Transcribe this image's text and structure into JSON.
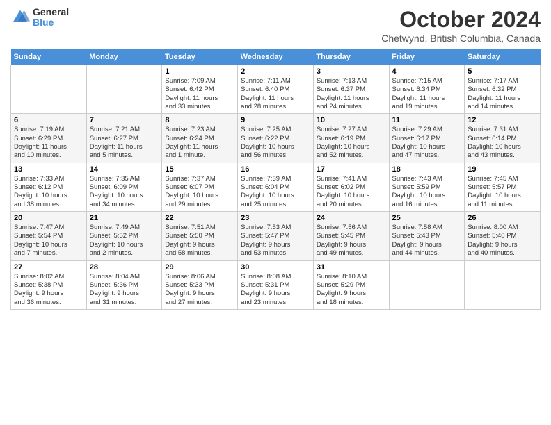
{
  "logo": {
    "general": "General",
    "blue": "Blue"
  },
  "title": "October 2024",
  "location": "Chetwynd, British Columbia, Canada",
  "headers": [
    "Sunday",
    "Monday",
    "Tuesday",
    "Wednesday",
    "Thursday",
    "Friday",
    "Saturday"
  ],
  "weeks": [
    [
      {
        "day": "",
        "info": ""
      },
      {
        "day": "",
        "info": ""
      },
      {
        "day": "1",
        "info": "Sunrise: 7:09 AM\nSunset: 6:42 PM\nDaylight: 11 hours\nand 33 minutes."
      },
      {
        "day": "2",
        "info": "Sunrise: 7:11 AM\nSunset: 6:40 PM\nDaylight: 11 hours\nand 28 minutes."
      },
      {
        "day": "3",
        "info": "Sunrise: 7:13 AM\nSunset: 6:37 PM\nDaylight: 11 hours\nand 24 minutes."
      },
      {
        "day": "4",
        "info": "Sunrise: 7:15 AM\nSunset: 6:34 PM\nDaylight: 11 hours\nand 19 minutes."
      },
      {
        "day": "5",
        "info": "Sunrise: 7:17 AM\nSunset: 6:32 PM\nDaylight: 11 hours\nand 14 minutes."
      }
    ],
    [
      {
        "day": "6",
        "info": "Sunrise: 7:19 AM\nSunset: 6:29 PM\nDaylight: 11 hours\nand 10 minutes."
      },
      {
        "day": "7",
        "info": "Sunrise: 7:21 AM\nSunset: 6:27 PM\nDaylight: 11 hours\nand 5 minutes."
      },
      {
        "day": "8",
        "info": "Sunrise: 7:23 AM\nSunset: 6:24 PM\nDaylight: 11 hours\nand 1 minute."
      },
      {
        "day": "9",
        "info": "Sunrise: 7:25 AM\nSunset: 6:22 PM\nDaylight: 10 hours\nand 56 minutes."
      },
      {
        "day": "10",
        "info": "Sunrise: 7:27 AM\nSunset: 6:19 PM\nDaylight: 10 hours\nand 52 minutes."
      },
      {
        "day": "11",
        "info": "Sunrise: 7:29 AM\nSunset: 6:17 PM\nDaylight: 10 hours\nand 47 minutes."
      },
      {
        "day": "12",
        "info": "Sunrise: 7:31 AM\nSunset: 6:14 PM\nDaylight: 10 hours\nand 43 minutes."
      }
    ],
    [
      {
        "day": "13",
        "info": "Sunrise: 7:33 AM\nSunset: 6:12 PM\nDaylight: 10 hours\nand 38 minutes."
      },
      {
        "day": "14",
        "info": "Sunrise: 7:35 AM\nSunset: 6:09 PM\nDaylight: 10 hours\nand 34 minutes."
      },
      {
        "day": "15",
        "info": "Sunrise: 7:37 AM\nSunset: 6:07 PM\nDaylight: 10 hours\nand 29 minutes."
      },
      {
        "day": "16",
        "info": "Sunrise: 7:39 AM\nSunset: 6:04 PM\nDaylight: 10 hours\nand 25 minutes."
      },
      {
        "day": "17",
        "info": "Sunrise: 7:41 AM\nSunset: 6:02 PM\nDaylight: 10 hours\nand 20 minutes."
      },
      {
        "day": "18",
        "info": "Sunrise: 7:43 AM\nSunset: 5:59 PM\nDaylight: 10 hours\nand 16 minutes."
      },
      {
        "day": "19",
        "info": "Sunrise: 7:45 AM\nSunset: 5:57 PM\nDaylight: 10 hours\nand 11 minutes."
      }
    ],
    [
      {
        "day": "20",
        "info": "Sunrise: 7:47 AM\nSunset: 5:54 PM\nDaylight: 10 hours\nand 7 minutes."
      },
      {
        "day": "21",
        "info": "Sunrise: 7:49 AM\nSunset: 5:52 PM\nDaylight: 10 hours\nand 2 minutes."
      },
      {
        "day": "22",
        "info": "Sunrise: 7:51 AM\nSunset: 5:50 PM\nDaylight: 9 hours\nand 58 minutes."
      },
      {
        "day": "23",
        "info": "Sunrise: 7:53 AM\nSunset: 5:47 PM\nDaylight: 9 hours\nand 53 minutes."
      },
      {
        "day": "24",
        "info": "Sunrise: 7:56 AM\nSunset: 5:45 PM\nDaylight: 9 hours\nand 49 minutes."
      },
      {
        "day": "25",
        "info": "Sunrise: 7:58 AM\nSunset: 5:43 PM\nDaylight: 9 hours\nand 44 minutes."
      },
      {
        "day": "26",
        "info": "Sunrise: 8:00 AM\nSunset: 5:40 PM\nDaylight: 9 hours\nand 40 minutes."
      }
    ],
    [
      {
        "day": "27",
        "info": "Sunrise: 8:02 AM\nSunset: 5:38 PM\nDaylight: 9 hours\nand 36 minutes."
      },
      {
        "day": "28",
        "info": "Sunrise: 8:04 AM\nSunset: 5:36 PM\nDaylight: 9 hours\nand 31 minutes."
      },
      {
        "day": "29",
        "info": "Sunrise: 8:06 AM\nSunset: 5:33 PM\nDaylight: 9 hours\nand 27 minutes."
      },
      {
        "day": "30",
        "info": "Sunrise: 8:08 AM\nSunset: 5:31 PM\nDaylight: 9 hours\nand 23 minutes."
      },
      {
        "day": "31",
        "info": "Sunrise: 8:10 AM\nSunset: 5:29 PM\nDaylight: 9 hours\nand 18 minutes."
      },
      {
        "day": "",
        "info": ""
      },
      {
        "day": "",
        "info": ""
      }
    ]
  ]
}
